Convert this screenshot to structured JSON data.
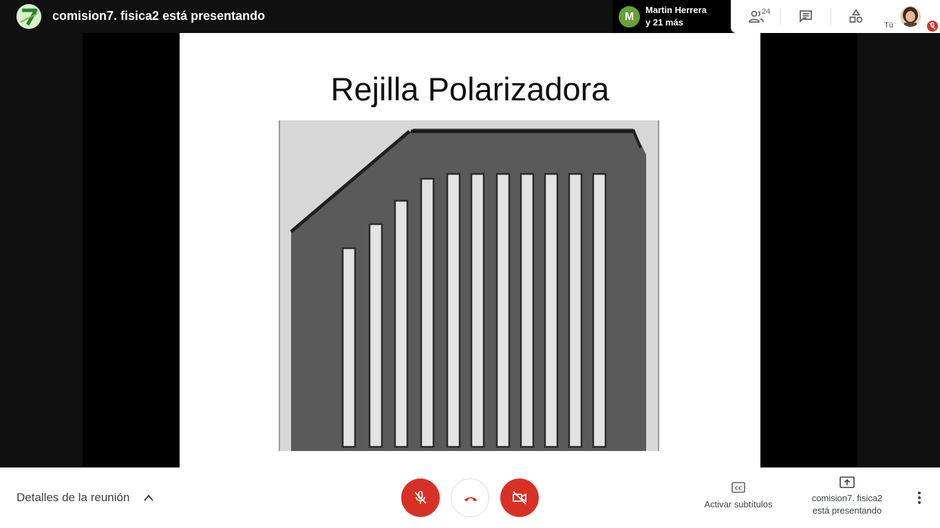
{
  "header": {
    "presenting_title": "comision7. fisica2 está presentando",
    "participant_name": "Martin Herrera",
    "participant_more": "y 21 más",
    "participant_initial": "M",
    "people_count": "24",
    "self_label": "Tú"
  },
  "slide": {
    "title": "Rejilla Polarizadora"
  },
  "footer": {
    "meeting_details": "Detalles de la reunión",
    "captions_label": "Activar subtítulos",
    "presenting_line1": "comision7. fisica2",
    "presenting_line2": "está presentando"
  },
  "icons": {
    "people": "people-icon",
    "chat": "chat-icon",
    "activities": "activities-icon",
    "mic_off": "mic-off-icon",
    "hangup": "hangup-icon",
    "camera_off": "camera-off-icon",
    "captions": "closed-captions-icon",
    "present": "present-screen-icon",
    "more": "more-vert-icon"
  },
  "colors": {
    "danger": "#d93025",
    "presenter_avatar": "#c8e6c9",
    "participant_avatar": "#689f38"
  }
}
